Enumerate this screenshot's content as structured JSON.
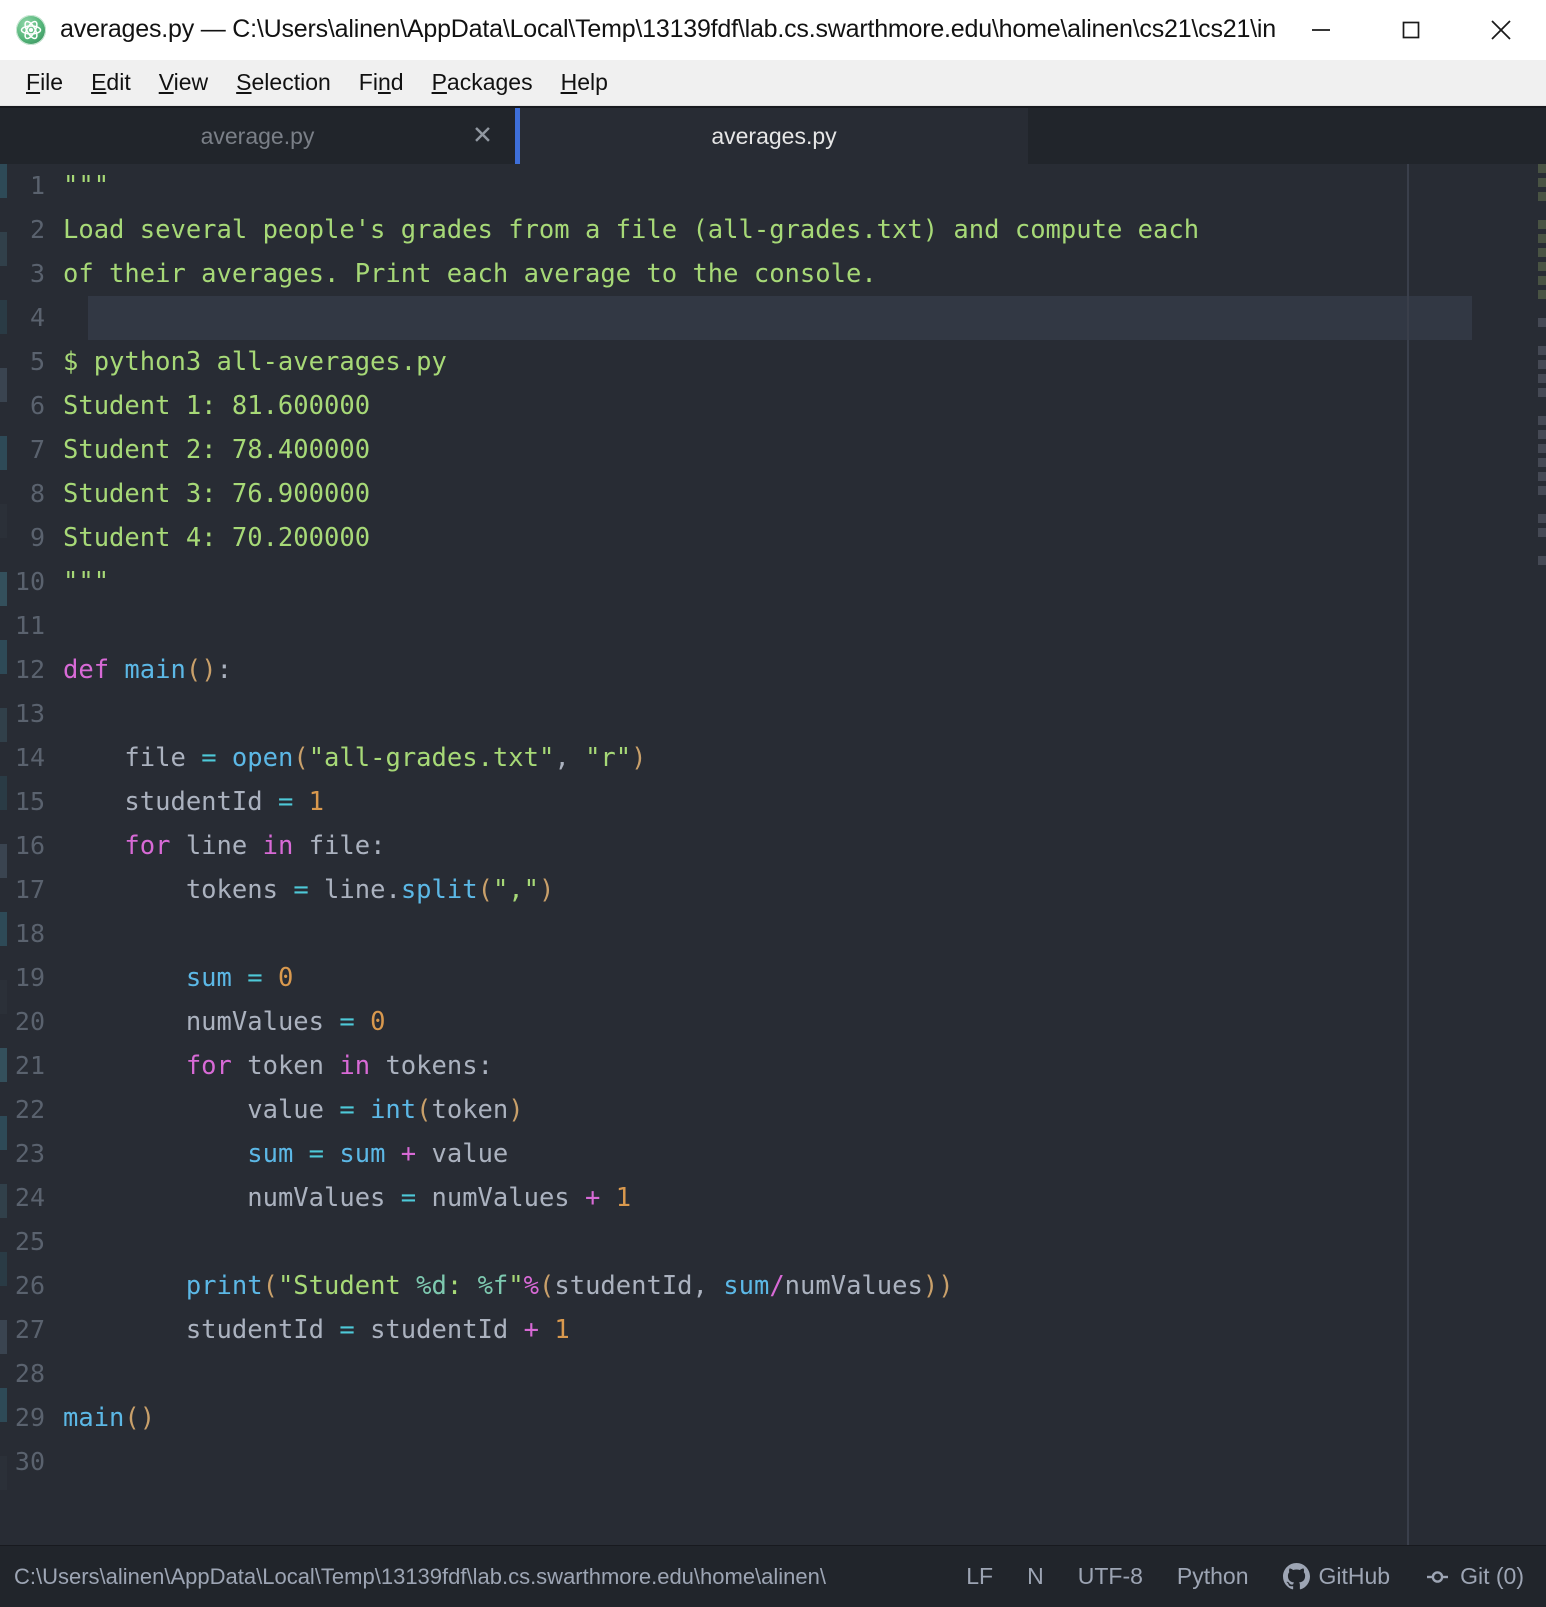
{
  "window": {
    "title": "averages.py — C:\\Users\\alinen\\AppData\\Local\\Temp\\13139fdf\\lab.cs.swarthmore.edu\\home\\alinen\\cs21\\cs21\\in...",
    "app_icon": "atom-icon",
    "controls": {
      "minimize": "minimize-icon",
      "maximize": "maximize-icon",
      "close": "close-icon"
    }
  },
  "menubar": {
    "items": [
      {
        "label": "File",
        "accel": "F"
      },
      {
        "label": "Edit",
        "accel": "E"
      },
      {
        "label": "View",
        "accel": "V"
      },
      {
        "label": "Selection",
        "accel": "S"
      },
      {
        "label": "Find",
        "accel": "n"
      },
      {
        "label": "Packages",
        "accel": "P"
      },
      {
        "label": "Help",
        "accel": "H"
      }
    ]
  },
  "tabs": [
    {
      "label": "average.py",
      "active": false,
      "close_icon": "close-icon",
      "close_glyph": "✕"
    },
    {
      "label": "averages.py",
      "active": true
    }
  ],
  "editor": {
    "language": "Python",
    "accent_color": "#3e6fd9",
    "background": "#282c34",
    "gutter_color": "#5a626e",
    "cursor_line": 4,
    "first_line": 1,
    "last_line": 30,
    "lines": [
      {
        "n": 1,
        "text": "\"\"\""
      },
      {
        "n": 2,
        "text": "Load several people's grades from a file (all-grades.txt) and compute each"
      },
      {
        "n": 3,
        "text": "of their averages. Print each average to the console."
      },
      {
        "n": 4,
        "text": ""
      },
      {
        "n": 5,
        "text": "$ python3 all-averages.py"
      },
      {
        "n": 6,
        "text": "Student 1: 81.600000"
      },
      {
        "n": 7,
        "text": "Student 2: 78.400000"
      },
      {
        "n": 8,
        "text": "Student 3: 76.900000"
      },
      {
        "n": 9,
        "text": "Student 4: 70.200000"
      },
      {
        "n": 10,
        "text": "\"\"\""
      },
      {
        "n": 11,
        "text": ""
      },
      {
        "n": 12,
        "text": "def main():"
      },
      {
        "n": 13,
        "text": ""
      },
      {
        "n": 14,
        "text": "    file = open(\"all-grades.txt\", \"r\")"
      },
      {
        "n": 15,
        "text": "    studentId = 1"
      },
      {
        "n": 16,
        "text": "    for line in file:"
      },
      {
        "n": 17,
        "text": "        tokens = line.split(\",\")"
      },
      {
        "n": 18,
        "text": ""
      },
      {
        "n": 19,
        "text": "        sum = 0"
      },
      {
        "n": 20,
        "text": "        numValues = 0"
      },
      {
        "n": 21,
        "text": "        for token in tokens:"
      },
      {
        "n": 22,
        "text": "            value = int(token)"
      },
      {
        "n": 23,
        "text": "            sum = sum + value"
      },
      {
        "n": 24,
        "text": "            numValues = numValues + 1"
      },
      {
        "n": 25,
        "text": ""
      },
      {
        "n": 26,
        "text": "        print(\"Student %d: %f\"%(studentId, sum/numValues))"
      },
      {
        "n": 27,
        "text": "        studentId = studentId + 1"
      },
      {
        "n": 28,
        "text": ""
      },
      {
        "n": 29,
        "text": "main()"
      },
      {
        "n": 30,
        "text": ""
      }
    ]
  },
  "statusbar": {
    "path": "C:\\Users\\alinen\\AppData\\Local\\Temp\\13139fdf\\lab.cs.swarthmore.edu\\home\\alinen\\",
    "line_ending": "LF",
    "indent": "N",
    "encoding": "UTF-8",
    "grammar": "Python",
    "github": "GitHub",
    "github_icon": "github-icon",
    "git": "Git (0)",
    "git_icon": "git-branch-icon"
  }
}
